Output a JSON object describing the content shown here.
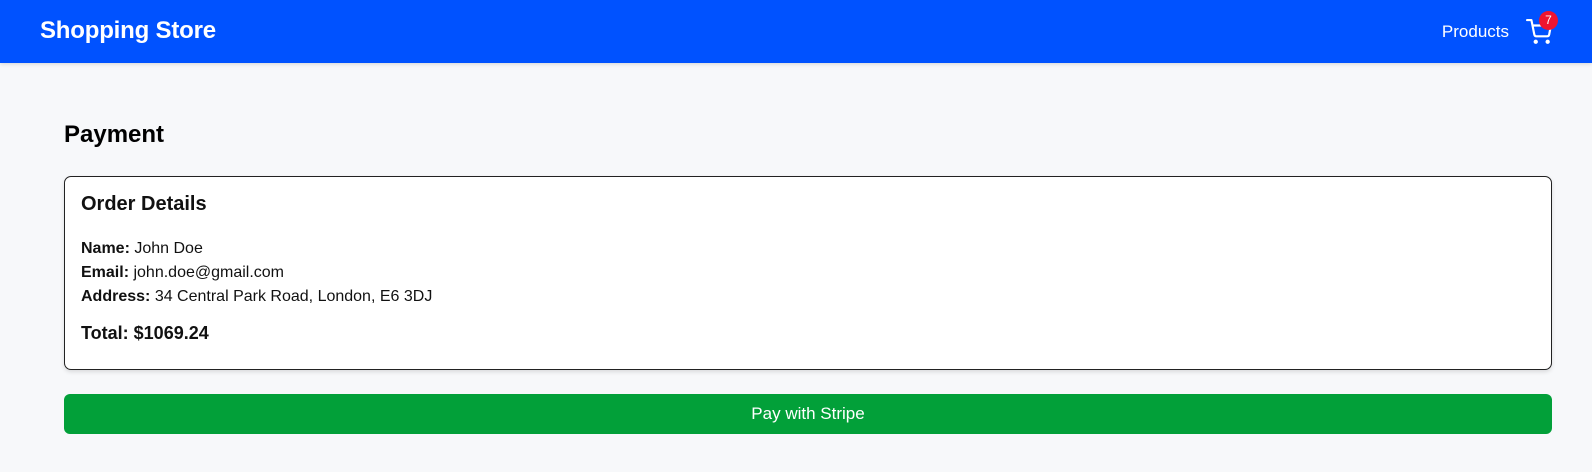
{
  "navbar": {
    "brand": "Shopping Store",
    "products_link": "Products",
    "cart_icon": "shopping-cart-icon",
    "cart_count": "7",
    "background_color": "#0052ff",
    "badge_color": "#ee1430"
  },
  "page": {
    "title": "Payment"
  },
  "order": {
    "title": "Order Details",
    "name_label": "Name:",
    "name_value": "John Doe",
    "email_label": "Email:",
    "email_value": "john.doe@gmail.com",
    "address_label": "Address:",
    "address_value": "34 Central Park Road, London, E6 3DJ",
    "total": "Total: $1069.24"
  },
  "actions": {
    "pay_label": "Pay with Stripe",
    "pay_color": "#02a039"
  }
}
